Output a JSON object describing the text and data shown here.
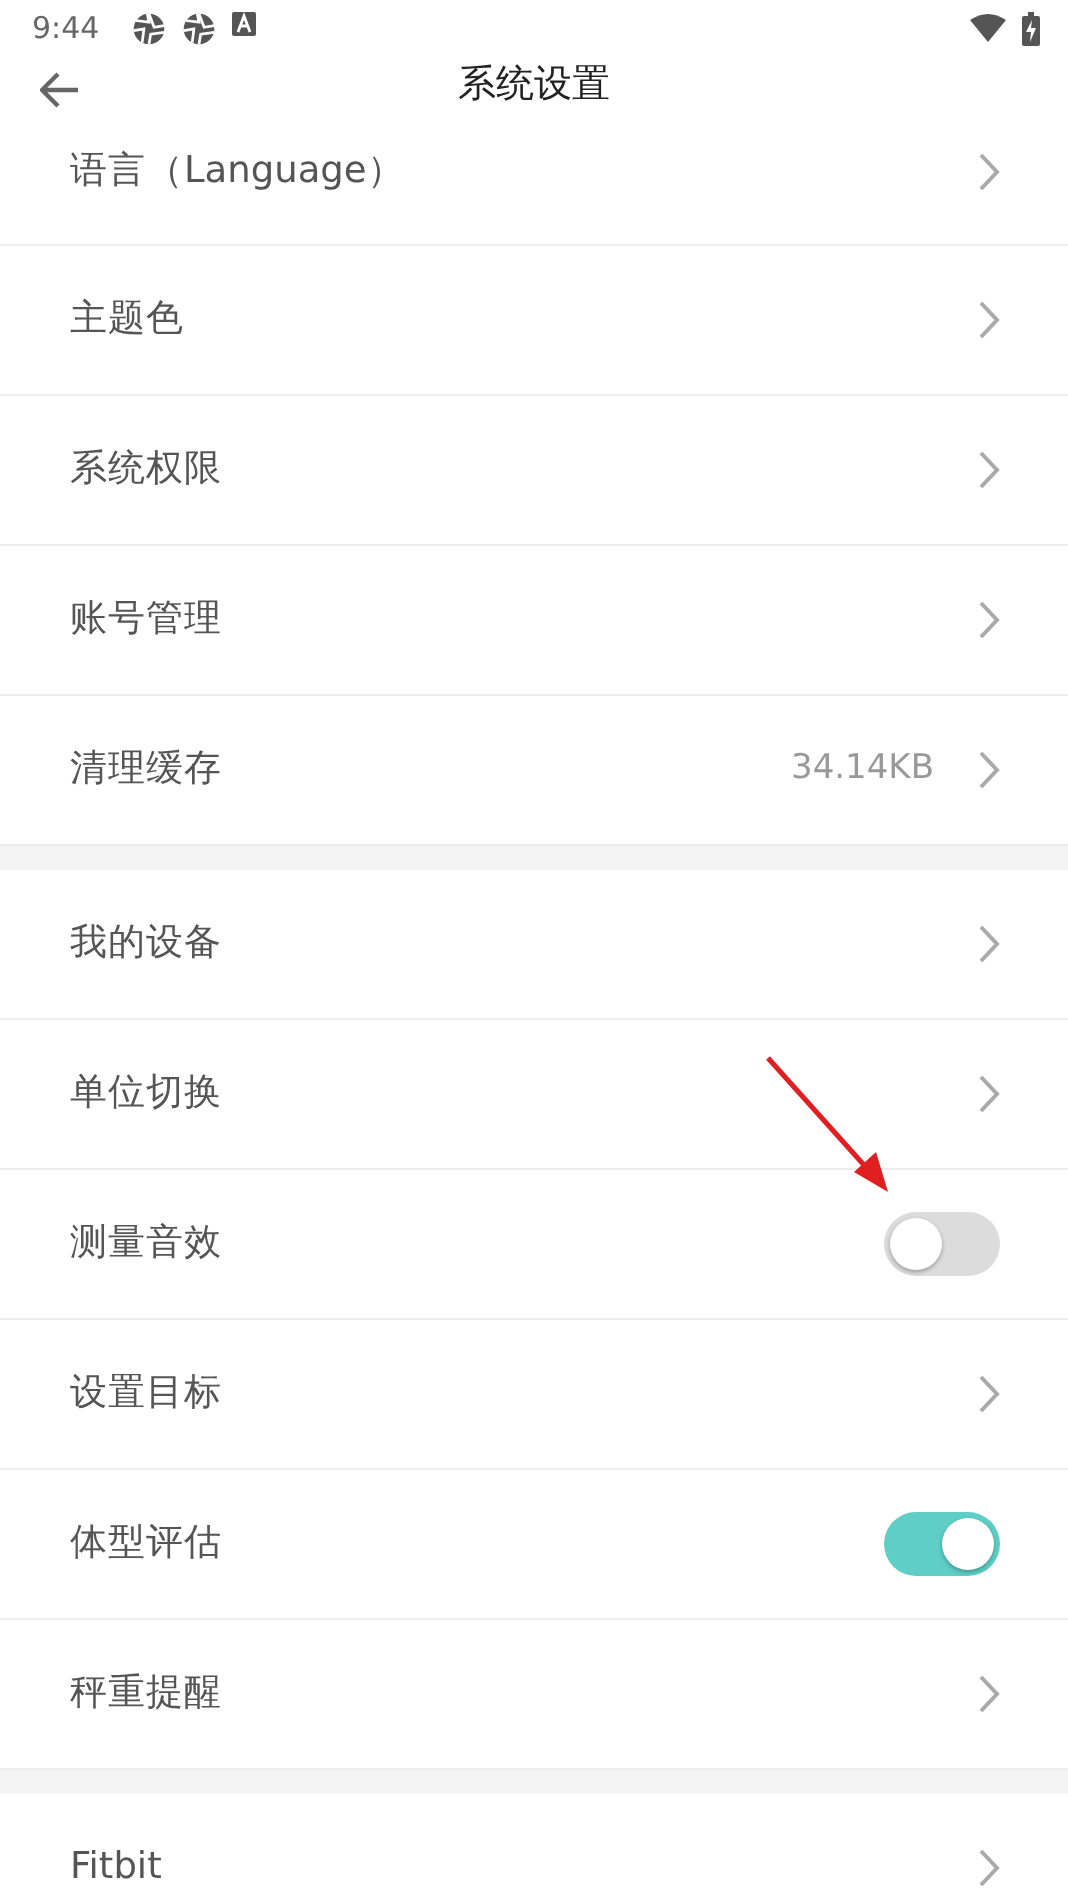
{
  "status_bar": {
    "time": "9:44"
  },
  "header": {
    "title": "系统设置"
  },
  "sections": [
    {
      "items": [
        {
          "kind": "link",
          "label": "语言（Language）"
        },
        {
          "kind": "link",
          "label": "主题色"
        },
        {
          "kind": "link",
          "label": "系统权限"
        },
        {
          "kind": "link",
          "label": "账号管理"
        },
        {
          "kind": "link",
          "label": "清理缓存",
          "value": "34.14KB"
        }
      ]
    },
    {
      "items": [
        {
          "kind": "link",
          "label": "我的设备"
        },
        {
          "kind": "link",
          "label": "单位切换"
        },
        {
          "kind": "toggle",
          "label": "测量音效",
          "on": false
        },
        {
          "kind": "link",
          "label": "设置目标"
        },
        {
          "kind": "toggle",
          "label": "体型评估",
          "on": true
        },
        {
          "kind": "link",
          "label": "秤重提醒"
        }
      ]
    },
    {
      "items": [
        {
          "kind": "link",
          "label": "Fitbit"
        }
      ]
    }
  ]
}
